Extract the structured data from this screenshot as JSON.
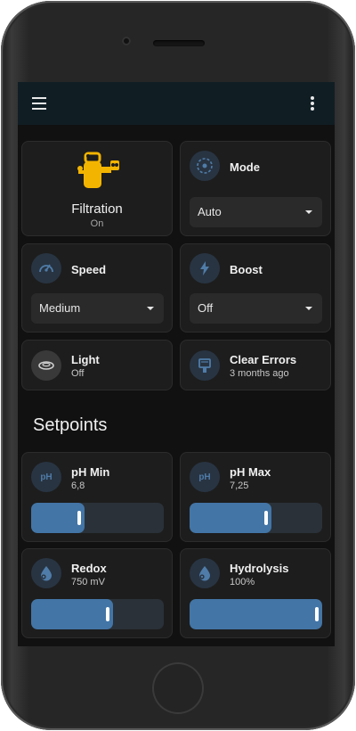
{
  "toolbar": {
    "menu_icon": "hamburger-menu-icon",
    "more_icon": "vertical-dots-icon"
  },
  "tiles": {
    "filtration": {
      "title": "Filtration",
      "state": "On",
      "icon": "pool-filter-icon",
      "icon_color": "#f3b400"
    },
    "mode": {
      "title": "Mode",
      "value": "Auto",
      "icon": "target-dots-icon"
    },
    "speed": {
      "title": "Speed",
      "value": "Medium",
      "icon": "gauge-icon"
    },
    "boost": {
      "title": "Boost",
      "value": "Off",
      "icon": "lightning-icon"
    },
    "light": {
      "title": "Light",
      "state": "Off",
      "icon": "ring-light-icon"
    },
    "clear_errors": {
      "title": "Clear Errors",
      "state": "3 months ago",
      "icon": "clear-errors-icon"
    }
  },
  "setpoints": {
    "heading": "Setpoints",
    "ph_min": {
      "title": "pH Min",
      "value": "6,8",
      "icon_text": "pH",
      "level_percent": 40
    },
    "ph_max": {
      "title": "pH Max",
      "value": "7,25",
      "icon_text": "pH",
      "level_percent": 62
    },
    "redox": {
      "title": "Redox",
      "value": "750 mV",
      "icon": "water-drop-gear-icon",
      "level_percent": 62
    },
    "hydrolysis": {
      "title": "Hydrolysis",
      "value": "100%",
      "icon": "water-drop-gear-icon",
      "level_percent": 100
    }
  },
  "colors": {
    "accent": "#4375a6",
    "card": "#1d1d1d",
    "background": "#111111",
    "topbar": "#101e24"
  }
}
